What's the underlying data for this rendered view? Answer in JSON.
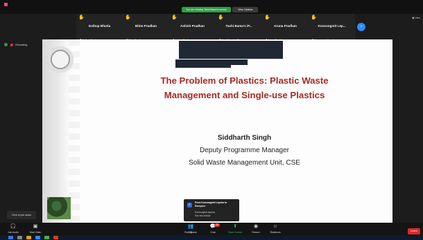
{
  "banner": {
    "viewing_text": "You are viewing Tashi Bamu's screen",
    "options_label": "View Options"
  },
  "top_right_label": "View",
  "participants": [
    {
      "display": "Dolhup Bhutia",
      "label": "Dolhup Bhutia"
    },
    {
      "display": "Bhim Pradhan",
      "label": "Bhim Pradhan"
    },
    {
      "display": "Ashish Pradhan",
      "label": "Ashish Pradhan"
    },
    {
      "display": "Tashi Bamu's iP...",
      "label": "Tashi Bamu's iPho..."
    },
    {
      "display": "Aruna Pradhan",
      "label": "Aruna Pradhan"
    },
    {
      "display": "Konsongmit Lep...",
      "label": "Konsongmit Lepcha"
    }
  ],
  "strip_next_icon": "chevron-right-icon",
  "recording_label": "Recording",
  "slide": {
    "title_line1": "The Problem of Plastics: Plastic Waste",
    "title_line2": "Management and Single-use Plastics",
    "presenter": "Siddharth Singh",
    "role": "Deputy Programme Manager",
    "unit": "Solid Waste Management Unit, CSE"
  },
  "chat_popup": {
    "avatar": "K",
    "from_line": "From Konsongmit Lepcha to",
    "to_line": "Everyone",
    "sender": "Konsongmit lepcha",
    "message": "Sss sss school"
  },
  "join_audio_label": "Click to join audio",
  "toolbar": {
    "join_audio": "Join Audio",
    "start_video": "Start Video",
    "participants": "Participants",
    "participant_count": "70",
    "chat": "Chat",
    "chat_badge": "29",
    "share_screen": "Share Screen",
    "record": "Record",
    "reactions": "Reactions",
    "leave": "Leave"
  },
  "colors": {
    "accent_green": "#2fbf58",
    "title_red": "#a52a22",
    "leave_red": "#e02828",
    "zoom_blue": "#2d8cff"
  }
}
